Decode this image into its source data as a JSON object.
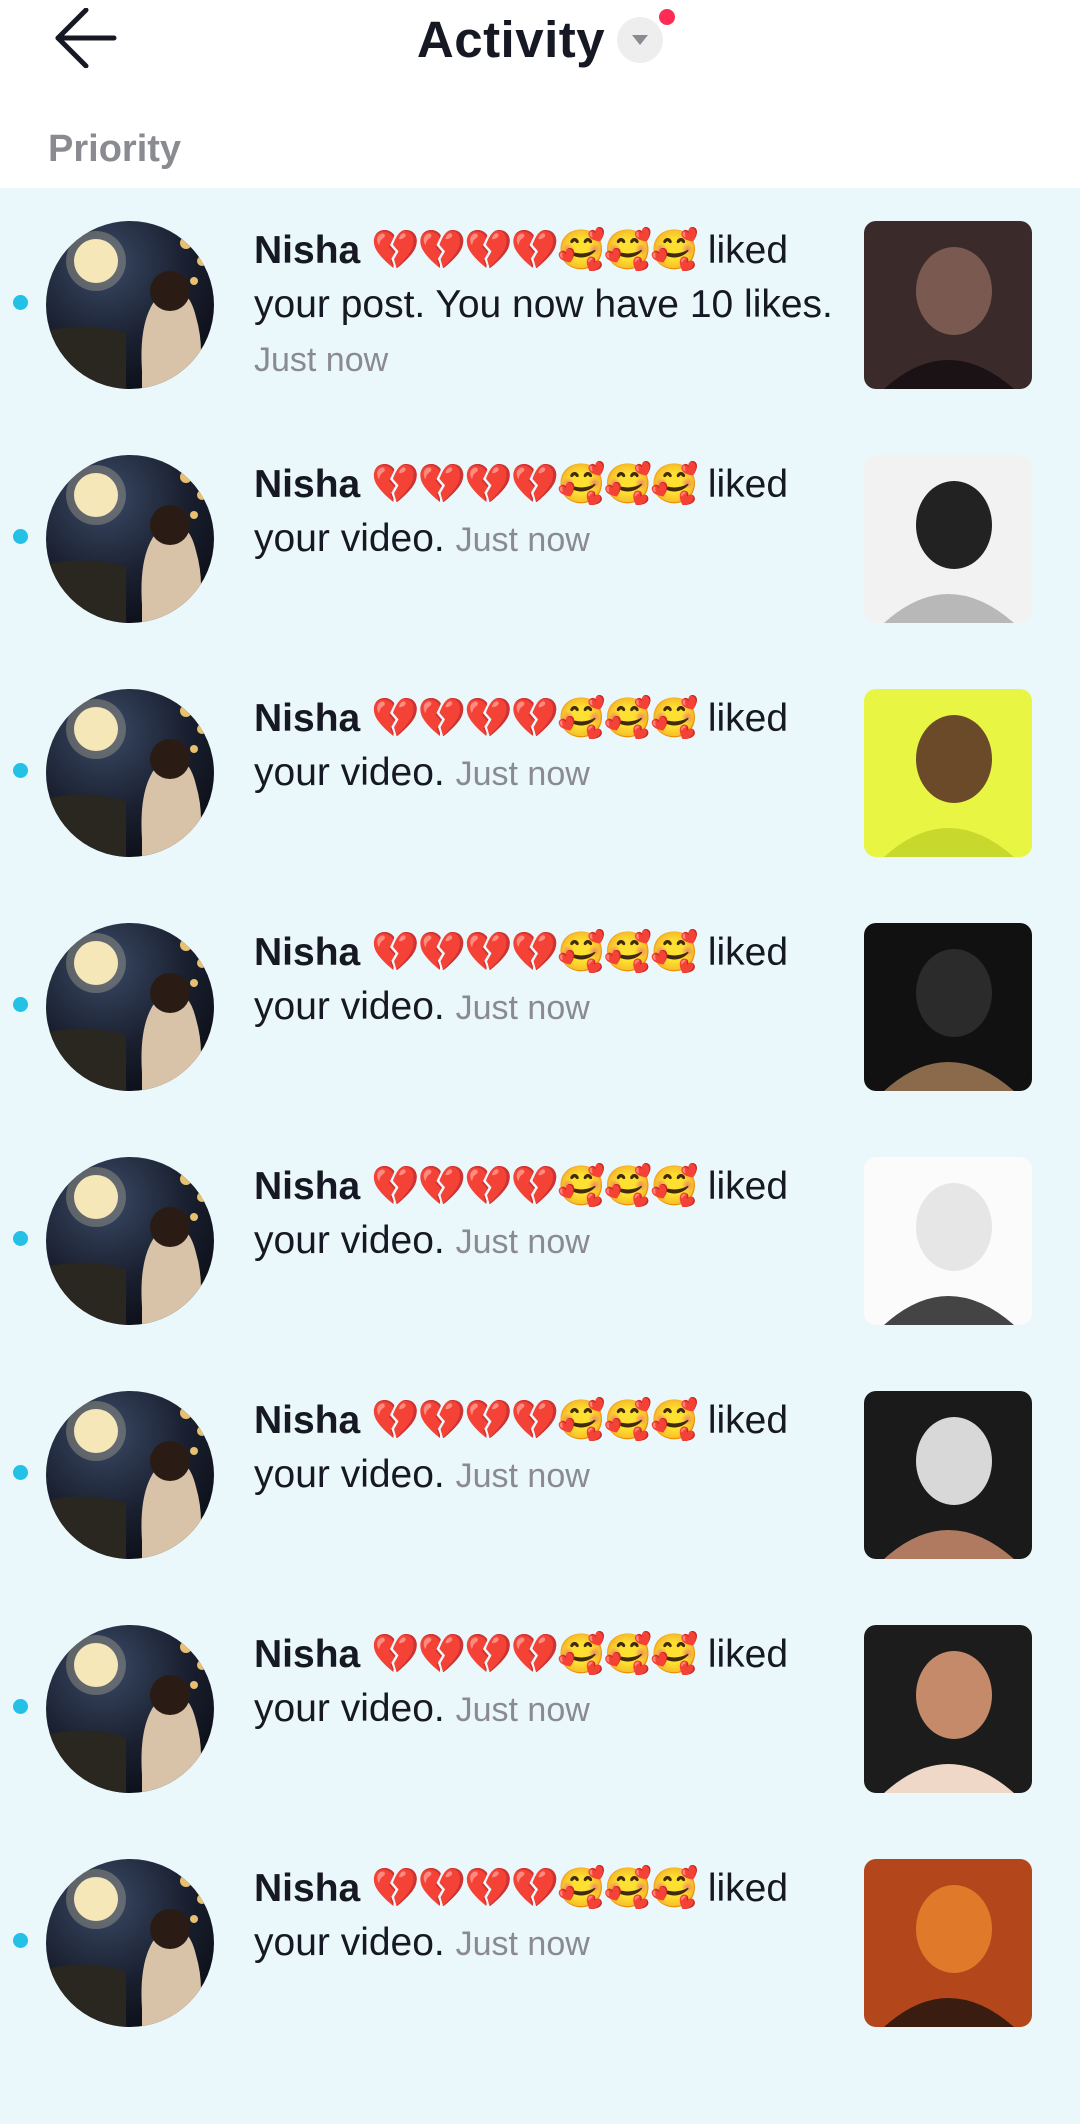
{
  "header": {
    "title": "Activity",
    "back_icon": "arrow-left-icon",
    "filter_icon": "caret-down-icon",
    "notification_color": "#fe2c55"
  },
  "section": {
    "label": "Priority"
  },
  "colors": {
    "list_bg": "#ebf8fb",
    "unread_dot": "#25c0e6",
    "muted_text": "#8a8b91"
  },
  "notifications": [
    {
      "name": "Nisha",
      "emojis": "💔💔💔💔🥰🥰🥰",
      "action": "liked your post. You now have 10 likes.",
      "time": "Just now"
    },
    {
      "name": "Nisha",
      "emojis": "💔💔💔💔🥰🥰🥰",
      "action": "liked your video.",
      "time": "Just now"
    },
    {
      "name": "Nisha",
      "emojis": "💔💔💔💔🥰🥰🥰",
      "action": "liked your video.",
      "time": "Just now"
    },
    {
      "name": "Nisha",
      "emojis": "💔💔💔💔🥰🥰🥰",
      "action": "liked your video.",
      "time": "Just now"
    },
    {
      "name": "Nisha",
      "emojis": "💔💔💔💔🥰🥰🥰",
      "action": "liked your video.",
      "time": "Just now"
    },
    {
      "name": "Nisha",
      "emojis": "💔💔💔💔🥰🥰🥰",
      "action": "liked your video.",
      "time": "Just now"
    },
    {
      "name": "Nisha",
      "emojis": "💔💔💔💔🥰🥰🥰",
      "action": "liked your video.",
      "time": "Just now"
    },
    {
      "name": "Nisha",
      "emojis": "💔💔💔💔🥰🥰🥰",
      "action": "liked your video.",
      "time": "Just now"
    }
  ]
}
